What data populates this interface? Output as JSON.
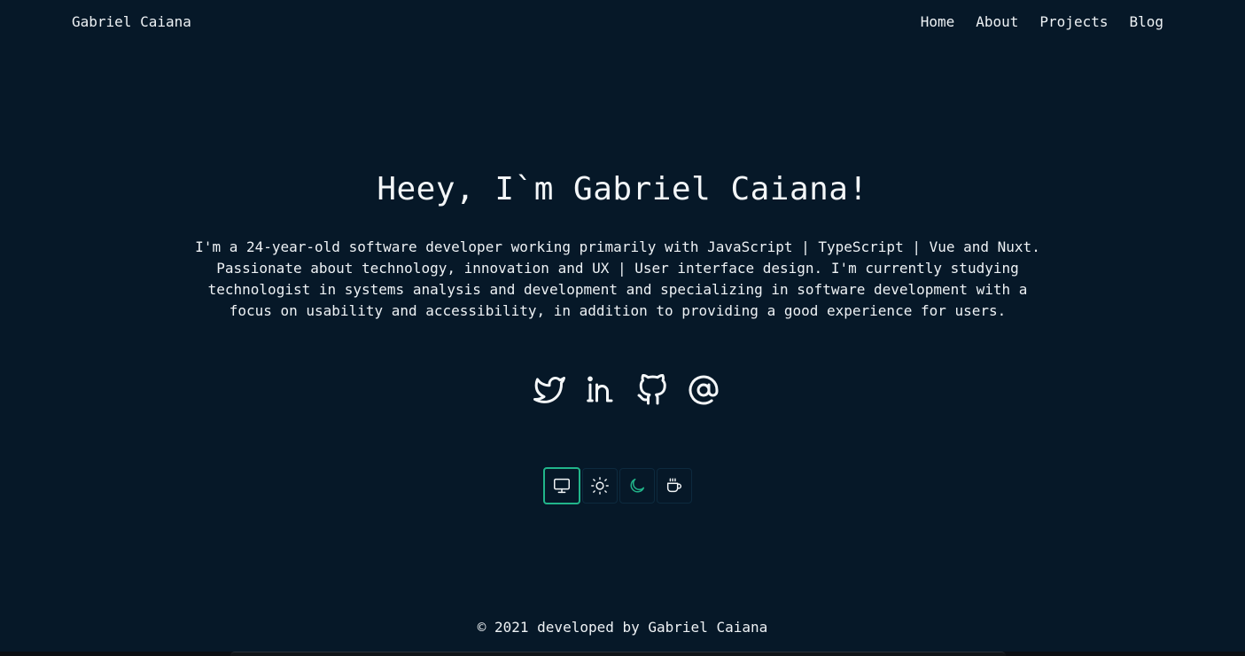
{
  "header": {
    "brand": "Gabriel Caiana",
    "nav": [
      {
        "label": "Home"
      },
      {
        "label": "About"
      },
      {
        "label": "Projects"
      },
      {
        "label": "Blog"
      }
    ]
  },
  "hero": {
    "title": "Heey, I`m Gabriel Caiana!",
    "bio": "I'm a 24-year-old software developer working primarily with JavaScript | TypeScript | Vue and Nuxt. Passionate about technology, innovation and UX | User interface design. I'm currently studying technologist in systems analysis and development and specializing in software development with a focus on usability and accessibility, in addition to providing a good experience for users."
  },
  "socials": [
    {
      "icon": "twitter-icon"
    },
    {
      "icon": "linkedin-icon"
    },
    {
      "icon": "github-icon"
    },
    {
      "icon": "at-sign-icon"
    }
  ],
  "theme_switcher": {
    "options": [
      {
        "icon": "monitor-icon",
        "active": true
      },
      {
        "icon": "sun-icon",
        "active": false
      },
      {
        "icon": "moon-icon",
        "active": false
      },
      {
        "icon": "coffee-icon",
        "active": false
      }
    ]
  },
  "footer": {
    "text": "© 2021 developed by Gabriel Caiana"
  },
  "colors": {
    "background": "#061828",
    "text": "#eef2f5",
    "accent": "#21b58a"
  }
}
